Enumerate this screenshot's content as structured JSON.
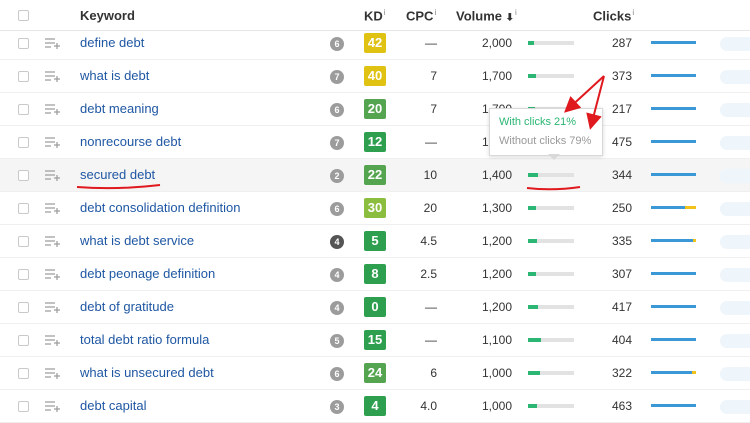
{
  "header": {
    "keyword": "Keyword",
    "kd": "KD",
    "cpc": "CPC",
    "volume": "Volume",
    "clicks": "Clicks",
    "info_mark": "i",
    "sort_arrow": "⬇"
  },
  "rows": [
    {
      "keyword": "define debt",
      "serp": "6",
      "kd": "42",
      "kd_color": "#e0c213",
      "cpc": "—",
      "volume": "2,000",
      "clicks_pct": 0.14,
      "clicks": "287",
      "yellow_pct": 0
    },
    {
      "keyword": "what is debt",
      "serp": "7",
      "kd": "40",
      "kd_color": "#e0c213",
      "cpc": "7",
      "volume": "1,700",
      "clicks_pct": 0.17,
      "clicks": "373",
      "yellow_pct": 0
    },
    {
      "keyword": "debt meaning",
      "serp": "6",
      "kd": "20",
      "kd_color": "#55a44f",
      "cpc": "7",
      "volume": "1,700",
      "clicks_pct": 0.15,
      "clicks": "217",
      "yellow_pct": 0
    },
    {
      "keyword": "nonrecourse debt",
      "serp": "7",
      "kd": "12",
      "kd_color": "#2d9f4e",
      "cpc": "—",
      "volume": "1,600",
      "clicks_pct": 0.15,
      "clicks": "475",
      "yellow_pct": 0
    },
    {
      "keyword": "secured debt",
      "serp": "2",
      "kd": "22",
      "kd_color": "#55a44f",
      "cpc": "10",
      "volume": "1,400",
      "clicks_pct": 0.21,
      "clicks": "344",
      "yellow_pct": 0
    },
    {
      "keyword": "debt consolidation definition",
      "serp": "6",
      "kd": "30",
      "kd_color": "#8bbe3f",
      "cpc": "20",
      "volume": "1,300",
      "clicks_pct": 0.17,
      "clicks": "250",
      "yellow_pct": 0.25
    },
    {
      "keyword": "what is debt service",
      "serp": "4",
      "kd": "5",
      "kd_color": "#2d9f4e",
      "cpc": "4.5",
      "volume": "1,200",
      "clicks_pct": 0.2,
      "clicks": "335",
      "yellow_pct": 0.06,
      "serp_dark": true
    },
    {
      "keyword": "debt peonage definition",
      "serp": "4",
      "kd": "8",
      "kd_color": "#2d9f4e",
      "cpc": "2.5",
      "volume": "1,200",
      "clicks_pct": 0.17,
      "clicks": "307",
      "yellow_pct": 0
    },
    {
      "keyword": "debt of gratitude",
      "serp": "4",
      "kd": "0",
      "kd_color": "#2d9f4e",
      "cpc": "—",
      "volume": "1,200",
      "clicks_pct": 0.22,
      "clicks": "417",
      "yellow_pct": 0
    },
    {
      "keyword": "total debt ratio formula",
      "serp": "5",
      "kd": "15",
      "kd_color": "#2d9f4e",
      "cpc": "—",
      "volume": "1,100",
      "clicks_pct": 0.28,
      "clicks": "404",
      "yellow_pct": 0
    },
    {
      "keyword": "what is unsecured debt",
      "serp": "6",
      "kd": "24",
      "kd_color": "#55a44f",
      "cpc": "6",
      "volume": "1,000",
      "clicks_pct": 0.27,
      "clicks": "322",
      "yellow_pct": 0.1
    },
    {
      "keyword": "debt capital",
      "serp": "3",
      "kd": "4",
      "kd_color": "#2d9f4e",
      "cpc": "4.0",
      "volume": "1,000",
      "clicks_pct": 0.2,
      "clicks": "463",
      "yellow_pct": 0
    }
  ],
  "tooltip": {
    "with_clicks": "With clicks 21%",
    "without_clicks": "Without clicks 79%"
  },
  "colors": {
    "link": "#1f57a3",
    "clicks_green": "#2bb673",
    "traffic_blue": "#3a98d6",
    "traffic_yellow": "#f1c21b",
    "annotation_red": "#e0191e"
  }
}
